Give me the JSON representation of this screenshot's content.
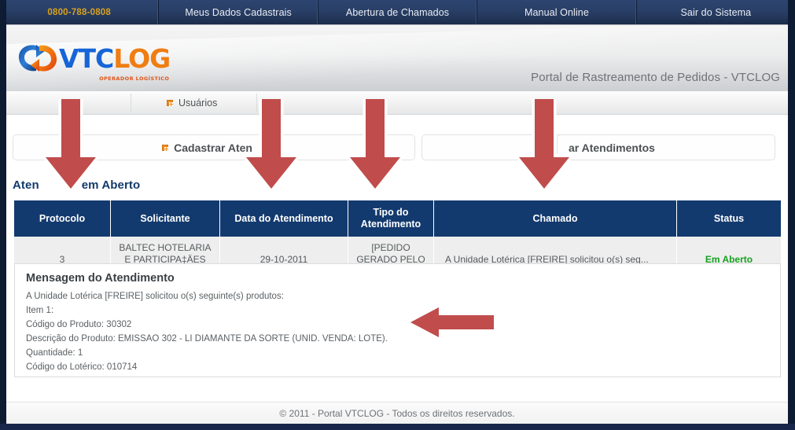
{
  "topnav": {
    "items": [
      {
        "label": "0800-788-0808",
        "kind": "phone"
      },
      {
        "label": "Meus Dados Cadastrais",
        "kind": "link"
      },
      {
        "label": "Abertura de Chamados",
        "kind": "link"
      },
      {
        "label": "Manual Online",
        "kind": "link"
      },
      {
        "label": "Sair do Sistema",
        "kind": "link"
      }
    ]
  },
  "brand": {
    "logo_vtc": "VTC",
    "logo_log": "LOG",
    "logo_subtitle": "OPERADOR LOGÍSTICO",
    "portal_title": "Portal de Rastreamento de Pedidos - VTCLOG"
  },
  "menubar": {
    "items": [
      {
        "label": "Usuários",
        "icon": "orange-square-icon"
      }
    ]
  },
  "panels": [
    {
      "label": "Cadastrar Aten",
      "icon": "orange-square-icon",
      "truncated": true
    },
    {
      "label": "ar Atendimentos",
      "icon": "none",
      "truncated": true
    }
  ],
  "page": {
    "heading_left": "Aten",
    "heading_right": "em Aberto"
  },
  "table": {
    "columns": [
      "Protocolo",
      "Solicitante",
      "Data do Atendimento",
      "Tipo do Atendimento",
      "Chamado",
      "Status"
    ],
    "rows": [
      {
        "protocolo": "3",
        "solicitante": "BALTEC HOTELARIA E PARTICIPA‡ÄES LTDA.",
        "data": "29-10-2011",
        "tipo": "[PEDIDO GERADO PELO PORTAL]",
        "chamado": "A Unidade Lotérica [FREIRE] solicitou o(s) seg...",
        "status": "Em Aberto"
      }
    ]
  },
  "message_panel": {
    "title": "Mensagem do Atendimento",
    "lines": [
      "A Unidade Lotérica [FREIRE] solicitou o(s) seguinte(s) produtos:",
      "Item 1:",
      "Código do Produto: 30302",
      "Descrição do Produto: EMISSAO 302 - LI DIAMANTE DA SORTE (UNID. VENDA: LOTE).",
      "Quantidade: 1",
      "Código do Lotérico: 010714"
    ]
  },
  "footer": {
    "text": "© 2011 - Portal VTCLOG - Todos os direitos reservados."
  },
  "annotations": {
    "arrow_color": "#c04c4c",
    "arrow_outline": "#ffffff",
    "count": 5
  },
  "colors": {
    "nav_blue": "#2a4068",
    "table_header_blue": "#133a6e",
    "status_green": "#16a11e",
    "phone_gold": "#d8a11f",
    "logo_blue": "#1565d8",
    "logo_orange": "#f07d12"
  }
}
